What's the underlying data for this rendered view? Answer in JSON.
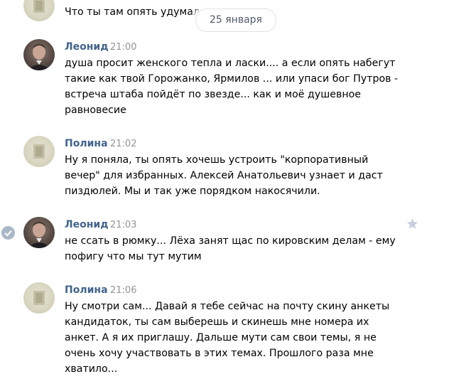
{
  "date_divider": "25 января",
  "messages": [
    {
      "author": "",
      "time": "",
      "text": "Что ты там опять удумал"
    },
    {
      "author": "Леонид",
      "time": "21:00",
      "text": "душа просит женского тепла и ласки.... а если опять набегут такие как твой Горожанко, Ярмилов ... или упаси бог Путров - встреча штаба пойдёт по звезде... как и моё душевное равновесие"
    },
    {
      "author": "Полина",
      "time": "21:02",
      "text": "Ну я поняла, ты опять хочешь устроить \"корпоративный вечер\" для избранных. Алексей Анатольевич узнает и даст пиздюлей. Мы и так уже порядком накосячили."
    },
    {
      "author": "Леонид",
      "time": "21:03",
      "text": "не ссать в рюмку... Лёха занят щас по кировским делам - ему пофигу что мы тут мутим"
    },
    {
      "author": "Полина",
      "time": "21:06",
      "text": "Ну смотри сам... Давай я тебе сейчас на почту скину анкеты кандидаток, ты сам выберешь и скинешь мне номера их анкет. А я их приглашу. Дальше мути сам свои темы, я не очень хочу участвовать в этих темах. Прошлого раза мне хватило..."
    }
  ],
  "icons": {
    "selected": "check-circle-icon",
    "favorite": "star-icon"
  },
  "colors": {
    "author": "#42648b",
    "time": "#939393",
    "check": "#aab7c8",
    "star": "#c5d0dc"
  }
}
